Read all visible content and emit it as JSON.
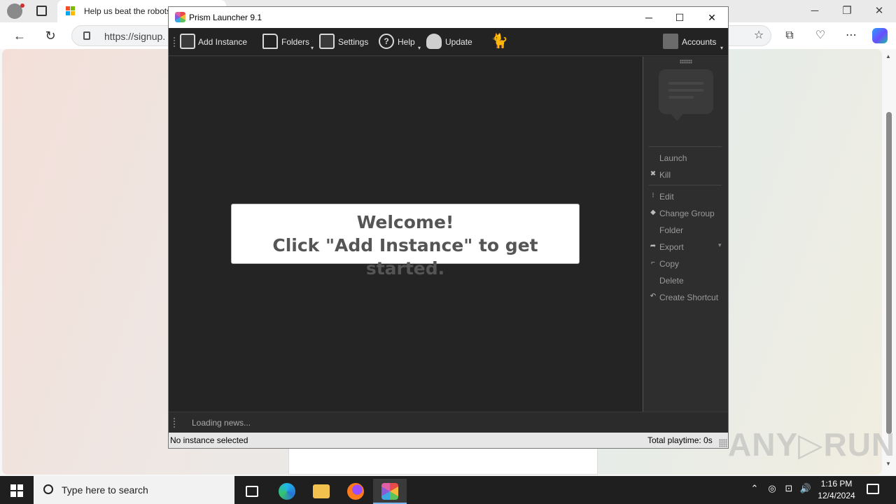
{
  "browser": {
    "tab_title": "Help us beat the robots",
    "url": "https://signup.",
    "win_controls": {
      "minimize": "─",
      "restore": "❐",
      "close": "✕"
    },
    "nav": {
      "back": "←",
      "refresh": "↻"
    },
    "toolbar_icons": {
      "favorites": "☆",
      "collections": "⧉",
      "extensions": "♡",
      "more": "⋯"
    }
  },
  "app": {
    "title": "Prism Launcher 9.1",
    "window_controls": {
      "minimize": "─",
      "maximize": "☐",
      "close": "✕"
    },
    "toolbar": {
      "add_instance": "Add Instance",
      "folders": "Folders",
      "settings": "Settings",
      "help": "Help",
      "update": "Update",
      "accounts": "Accounts",
      "dropdown_arrow": "▾"
    },
    "welcome": {
      "line1": "Welcome!",
      "line2": "Click \"Add Instance\" to get started."
    },
    "actions": {
      "launch": "Launch",
      "kill": "Kill",
      "edit": "Edit",
      "change_group": "Change Group",
      "folder": "Folder",
      "export": "Export",
      "copy": "Copy",
      "delete": "Delete",
      "create_shortcut": "Create Shortcut"
    },
    "news": "Loading news...",
    "status": {
      "selection": "No instance selected",
      "playtime": "Total playtime: 0s"
    }
  },
  "watermark": "ANY▷RUN",
  "taskbar": {
    "search_placeholder": "Type here to search",
    "time": "1:16 PM",
    "date": "12/4/2024",
    "tray_icons": {
      "chevron": "⌃",
      "network": "⊡",
      "volume": "🔊"
    }
  }
}
